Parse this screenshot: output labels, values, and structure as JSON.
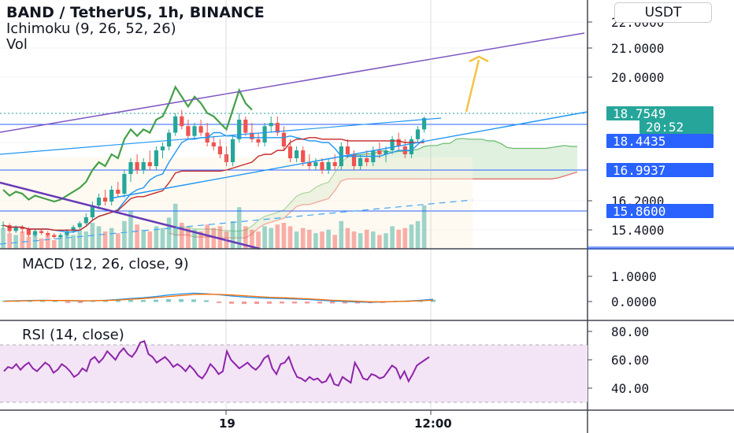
{
  "header": {
    "title": "BAND / TetherUS, 1h, BINANCE",
    "indicator": "Ichimoku (9, 26, 52, 26)",
    "volume": "Vol",
    "currency_button": "USDT"
  },
  "colors": {
    "up": "#26a69a",
    "down": "#ef5350",
    "ichimoku_lagging": "#43a047",
    "ichimoku_conversion": "#2196f3",
    "ichimoku_base": "#e53935",
    "cloud_green": "#a5d6a7",
    "cloud_red": "#ef9a9a",
    "trend_purple": "#7e57c2",
    "trend_blue": "#2196f3",
    "arrow": "#f5c242",
    "macd": "#2196f3",
    "signal": "#ff6d00",
    "rsi": "#9c27b0",
    "rsi_band": "#f3e5f5"
  },
  "chart_data": [
    {
      "type": "candlestick",
      "pane": "price",
      "y_ticks": [
        "22.0000",
        "21.0000",
        "20.0000",
        "16.2000",
        "15.4000"
      ],
      "price_tags": [
        {
          "label": "18.7549",
          "color": "#26a69a"
        },
        {
          "label": "20:52",
          "color": "#26a69a"
        },
        {
          "label": "18.4435",
          "color": "#2962ff"
        },
        {
          "label": "16.9937",
          "color": "#2962ff"
        },
        {
          "label": "15.8600",
          "color": "#2962ff"
        }
      ],
      "candles": [
        [
          15.9,
          16.0,
          15.8,
          15.9
        ],
        [
          15.9,
          15.95,
          15.7,
          15.75
        ],
        [
          15.75,
          15.9,
          15.7,
          15.85
        ],
        [
          15.85,
          15.9,
          15.7,
          15.8
        ],
        [
          15.8,
          15.85,
          15.6,
          15.65
        ],
        [
          15.65,
          15.8,
          15.6,
          15.75
        ],
        [
          15.75,
          15.8,
          15.65,
          15.7
        ],
        [
          15.7,
          15.75,
          15.6,
          15.65
        ],
        [
          15.65,
          15.7,
          15.55,
          15.6
        ],
        [
          15.6,
          15.7,
          15.55,
          15.65
        ],
        [
          15.65,
          15.8,
          15.6,
          15.75
        ],
        [
          15.75,
          15.9,
          15.7,
          15.85
        ],
        [
          15.85,
          16.0,
          15.8,
          15.95
        ],
        [
          15.95,
          16.2,
          15.9,
          16.1
        ],
        [
          16.1,
          16.5,
          16.0,
          16.4
        ],
        [
          16.4,
          16.7,
          16.3,
          16.6
        ],
        [
          16.6,
          16.8,
          16.4,
          16.5
        ],
        [
          16.5,
          16.9,
          16.4,
          16.8
        ],
        [
          16.8,
          17.0,
          16.6,
          16.7
        ],
        [
          16.7,
          17.3,
          16.6,
          17.2
        ],
        [
          17.2,
          17.6,
          17.0,
          17.5
        ],
        [
          17.5,
          17.7,
          17.2,
          17.3
        ],
        [
          17.3,
          17.6,
          17.2,
          17.5
        ],
        [
          17.5,
          17.8,
          17.3,
          17.4
        ],
        [
          17.4,
          17.9,
          17.3,
          17.8
        ],
        [
          17.8,
          18.0,
          17.6,
          17.9
        ],
        [
          17.9,
          18.4,
          17.8,
          18.3
        ],
        [
          18.3,
          18.9,
          18.2,
          18.8
        ],
        [
          18.8,
          19.0,
          18.4,
          18.5
        ],
        [
          18.5,
          18.7,
          18.1,
          18.2
        ],
        [
          18.2,
          18.6,
          18.1,
          18.5
        ],
        [
          18.5,
          18.7,
          18.2,
          18.3
        ],
        [
          18.3,
          18.6,
          17.9,
          18.0
        ],
        [
          18.0,
          18.2,
          17.8,
          17.9
        ],
        [
          17.9,
          18.1,
          17.6,
          17.7
        ],
        [
          17.7,
          17.9,
          17.4,
          17.5
        ],
        [
          17.5,
          18.2,
          17.4,
          18.1
        ],
        [
          18.1,
          18.9,
          18.0,
          18.7
        ],
        [
          18.7,
          18.8,
          18.2,
          18.3
        ],
        [
          18.3,
          18.6,
          18.0,
          18.1
        ],
        [
          18.1,
          18.3,
          17.9,
          18.0
        ],
        [
          18.0,
          18.6,
          17.9,
          18.5
        ],
        [
          18.5,
          18.8,
          18.3,
          18.6
        ],
        [
          18.6,
          18.8,
          18.2,
          18.3
        ],
        [
          18.3,
          18.5,
          17.8,
          17.9
        ],
        [
          17.9,
          18.1,
          17.5,
          17.6
        ],
        [
          17.6,
          17.9,
          17.5,
          17.8
        ],
        [
          17.8,
          17.9,
          17.4,
          17.5
        ],
        [
          17.5,
          17.7,
          17.3,
          17.4
        ],
        [
          17.4,
          17.6,
          17.3,
          17.5
        ],
        [
          17.5,
          17.6,
          17.2,
          17.3
        ],
        [
          17.3,
          17.6,
          17.2,
          17.5
        ],
        [
          17.5,
          17.7,
          17.3,
          17.4
        ],
        [
          17.4,
          18.0,
          17.3,
          17.9
        ],
        [
          17.9,
          18.1,
          17.6,
          17.7
        ],
        [
          17.7,
          17.8,
          17.3,
          17.4
        ],
        [
          17.4,
          17.7,
          17.3,
          17.6
        ],
        [
          17.6,
          17.8,
          17.4,
          17.5
        ],
        [
          17.5,
          17.9,
          17.4,
          17.8
        ],
        [
          17.8,
          18.0,
          17.6,
          17.7
        ],
        [
          17.7,
          17.9,
          17.5,
          17.8
        ],
        [
          17.8,
          18.2,
          17.7,
          18.1
        ],
        [
          18.1,
          18.3,
          17.8,
          17.9
        ],
        [
          17.9,
          18.1,
          17.6,
          17.7
        ],
        [
          17.7,
          18.2,
          17.6,
          18.1
        ],
        [
          18.1,
          18.5,
          18.0,
          18.4
        ],
        [
          18.4,
          18.8,
          18.3,
          18.75
        ]
      ],
      "volume": [
        1.2,
        0.9,
        0.8,
        1.0,
        0.7,
        0.9,
        0.6,
        0.8,
        0.5,
        0.7,
        0.9,
        0.8,
        1.1,
        1.0,
        1.5,
        1.3,
        1.0,
        1.2,
        0.9,
        1.6,
        2.2,
        1.4,
        1.1,
        1.0,
        1.3,
        1.2,
        1.8,
        2.6,
        1.5,
        1.2,
        1.1,
        1.0,
        1.4,
        1.2,
        1.3,
        1.0,
        1.6,
        2.4,
        1.3,
        1.1,
        1.0,
        1.3,
        1.2,
        1.4,
        1.5,
        1.3,
        1.0,
        1.2,
        1.1,
        0.9,
        1.0,
        1.1,
        0.8,
        1.6,
        1.2,
        1.0,
        0.9,
        1.1,
        1.0,
        0.8,
        0.9,
        1.3,
        1.1,
        1.2,
        1.4,
        1.6,
        2.5
      ]
    },
    {
      "type": "histogram+line",
      "pane": "macd",
      "title": "MACD (12, 26, close, 9)",
      "y_ticks": [
        "1.0000",
        "0.0000"
      ],
      "macd": [
        0.02,
        0.03,
        0.04,
        0.05,
        0.04,
        0.03,
        0.02,
        0.03,
        0.05,
        0.08,
        0.12,
        0.15,
        0.2,
        0.26,
        0.3,
        0.33,
        0.31,
        0.27,
        0.22,
        0.18,
        0.15,
        0.13,
        0.12,
        0.1,
        0.08,
        0.05,
        0.02,
        0.0,
        -0.02,
        -0.03,
        -0.02,
        0.0,
        0.02,
        0.05,
        0.09
      ],
      "signal": [
        0.01,
        0.02,
        0.03,
        0.04,
        0.04,
        0.04,
        0.03,
        0.03,
        0.04,
        0.06,
        0.09,
        0.12,
        0.16,
        0.2,
        0.24,
        0.28,
        0.29,
        0.28,
        0.26,
        0.23,
        0.2,
        0.17,
        0.15,
        0.13,
        0.11,
        0.08,
        0.05,
        0.03,
        0.01,
        -0.01,
        -0.01,
        0.0,
        0.01,
        0.03,
        0.05
      ]
    },
    {
      "type": "line",
      "pane": "rsi",
      "title": "RSI (14, close)",
      "y_ticks": [
        "80.00",
        "60.00",
        "40.00"
      ],
      "band": [
        30,
        70
      ],
      "values": [
        52,
        55,
        54,
        57,
        53,
        56,
        58,
        54,
        52,
        55,
        58,
        56,
        51,
        53,
        57,
        55,
        52,
        48,
        50,
        54,
        52,
        60,
        62,
        58,
        61,
        66,
        63,
        60,
        65,
        68,
        64,
        62,
        66,
        72,
        73,
        64,
        62,
        58,
        60,
        62,
        59,
        55,
        57,
        55,
        52,
        56,
        53,
        49,
        47,
        51,
        57,
        54,
        50,
        52,
        66,
        60,
        57,
        54,
        56,
        58,
        55,
        53,
        56,
        61,
        63,
        54,
        50,
        57,
        58,
        62,
        54,
        48,
        47,
        45,
        48,
        46,
        47,
        44,
        45,
        50,
        43,
        42,
        48,
        46,
        44,
        58,
        53,
        47,
        46,
        50,
        49,
        47,
        48,
        52,
        56,
        54,
        47,
        52,
        45,
        50,
        56,
        58,
        60,
        62
      ]
    }
  ],
  "time_axis": {
    "labels": [
      "19",
      "12:00"
    ]
  }
}
